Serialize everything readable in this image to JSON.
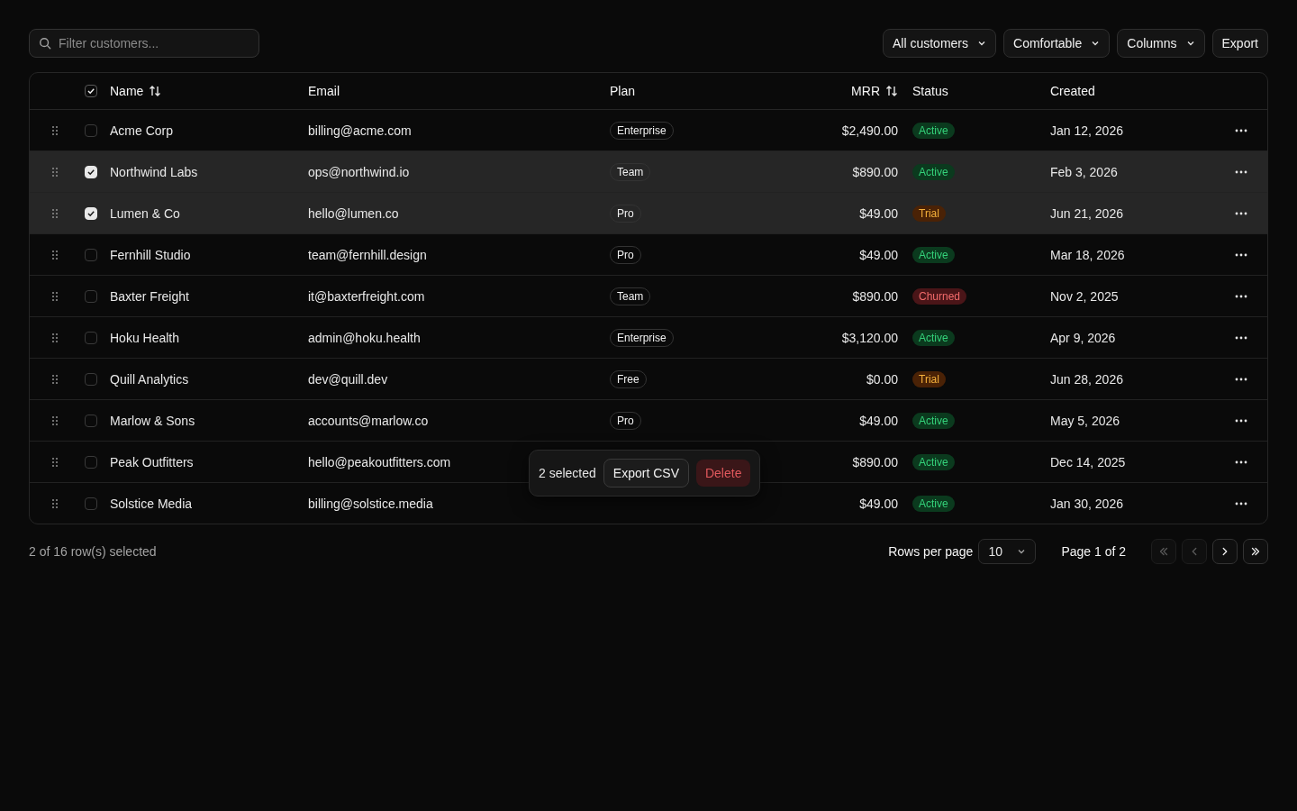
{
  "toolbar": {
    "search": {
      "placeholder": "Filter customers..."
    },
    "dropdowns": [
      {
        "label": "All customers"
      },
      {
        "label": "Comfortable"
      },
      {
        "label": "Columns"
      }
    ],
    "export_button": "Export"
  },
  "table": {
    "select_all": {
      "checked": true
    },
    "columns": [
      {
        "label": "Name",
        "sortable": true
      },
      {
        "label": "Email",
        "sortable": false
      },
      {
        "label": "Plan",
        "sortable": false
      },
      {
        "label": "MRR",
        "sortable": true
      },
      {
        "label": "Status",
        "sortable": false
      },
      {
        "label": "Created",
        "sortable": false
      }
    ],
    "rows": [
      {
        "name": "Acme Corp",
        "email": "billing@acme.com",
        "plan": "Enterprise",
        "mrr": "$2,490.00",
        "status": {
          "label": "Active",
          "kind": "active"
        },
        "created": "Jan 12, 2026",
        "selected": false
      },
      {
        "name": "Northwind Labs",
        "email": "ops@northwind.io",
        "plan": "Team",
        "mrr": "$890.00",
        "status": {
          "label": "Active",
          "kind": "active"
        },
        "created": "Feb 3, 2026",
        "selected": true
      },
      {
        "name": "Lumen & Co",
        "email": "hello@lumen.co",
        "plan": "Pro",
        "mrr": "$49.00",
        "status": {
          "label": "Trial",
          "kind": "trial"
        },
        "created": "Jun 21, 2026",
        "selected": true
      },
      {
        "name": "Fernhill Studio",
        "email": "team@fernhill.design",
        "plan": "Pro",
        "mrr": "$49.00",
        "status": {
          "label": "Active",
          "kind": "active"
        },
        "created": "Mar 18, 2026",
        "selected": false
      },
      {
        "name": "Baxter Freight",
        "email": "it@baxterfreight.com",
        "plan": "Team",
        "mrr": "$890.00",
        "status": {
          "label": "Churned",
          "kind": "churned"
        },
        "created": "Nov 2, 2025",
        "selected": false
      },
      {
        "name": "Hoku Health",
        "email": "admin@hoku.health",
        "plan": "Enterprise",
        "mrr": "$3,120.00",
        "status": {
          "label": "Active",
          "kind": "active"
        },
        "created": "Apr 9, 2026",
        "selected": false
      },
      {
        "name": "Quill Analytics",
        "email": "dev@quill.dev",
        "plan": "Free",
        "mrr": "$0.00",
        "status": {
          "label": "Trial",
          "kind": "trial"
        },
        "created": "Jun 28, 2026",
        "selected": false
      },
      {
        "name": "Marlow & Sons",
        "email": "accounts@marlow.co",
        "plan": "Pro",
        "mrr": "$49.00",
        "status": {
          "label": "Active",
          "kind": "active"
        },
        "created": "May 5, 2026",
        "selected": false
      },
      {
        "name": "Peak Outfitters",
        "email": "hello@peakoutfitters.com",
        "mrr": "$890.00",
        "status": {
          "label": "Active",
          "kind": "active"
        },
        "created": "Dec 14, 2025",
        "selected": false
      },
      {
        "name": "Solstice Media",
        "email": "billing@solstice.media",
        "mrr": "$49.00",
        "status": {
          "label": "Active",
          "kind": "active"
        },
        "created": "Jan 30, 2026",
        "selected": false
      }
    ]
  },
  "bulk_bar": {
    "count": "2 selected",
    "export_button": "Export CSV",
    "delete_button": "Delete"
  },
  "footer": {
    "selection": "2 of 16 row(s) selected",
    "rows_per_page_label": "Rows per page",
    "rows_per_page": "10",
    "page": "Page 1 of 2",
    "nav": [
      {
        "kind": "first",
        "disabled": true
      },
      {
        "kind": "prev",
        "disabled": true
      },
      {
        "kind": "next",
        "disabled": false
      },
      {
        "kind": "last",
        "disabled": false
      }
    ]
  }
}
